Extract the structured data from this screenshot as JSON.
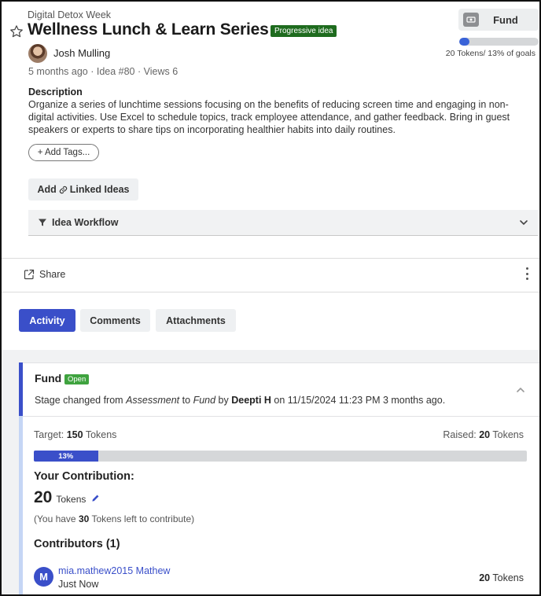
{
  "idea": {
    "campaign": "Digital Detox Week",
    "title": "Wellness Lunch & Learn Series",
    "status_badge": "Progressive idea",
    "author": "Josh Mulling",
    "meta": "5 months ago · Idea #80 · Views 6",
    "description_heading": "Description",
    "description": "Organize a series of lunchtime sessions focusing on the benefits of reducing screen time and engaging in non-digital activities. Use Excel to schedule topics, track employee attendance, and gather feedback. Bring in guest speakers or experts to share tips on incorporating healthier habits into daily routines.",
    "add_tags_label": "+ Add Tags...",
    "linked_ideas_prefix": "Add",
    "linked_ideas_label": "Linked Ideas",
    "workflow_label": "Idea Workflow"
  },
  "fund_widget": {
    "button_label": "Fund",
    "progress_fraction": 0.13,
    "summary": "20 Tokens/ 13% of goals"
  },
  "share": {
    "label": "Share"
  },
  "tabs": [
    {
      "label": "Activity",
      "active": true
    },
    {
      "label": "Comments",
      "active": false
    },
    {
      "label": "Attachments",
      "active": false
    }
  ],
  "activity_card": {
    "title": "Fund",
    "badge": "Open",
    "stage_prefix": "Stage changed from",
    "stage_from": "Assessment",
    "stage_to_word": "to",
    "stage_to": "Fund",
    "stage_by_word": "by",
    "stage_by": "Deepti H",
    "stage_date": "on 11/15/2024 11:23 PM 3 months ago.",
    "target_label": "Target:",
    "target_value": "150",
    "target_unit": "Tokens",
    "raised_label": "Raised:",
    "raised_value": "20",
    "raised_unit": "Tokens",
    "progress_fraction": 0.13,
    "progress_label": "13%",
    "your_contribution_heading": "Your Contribution:",
    "your_contribution_value": "20",
    "your_contribution_unit": "Tokens",
    "left_prefix": "(You have",
    "left_value": "30",
    "left_suffix": "Tokens left to contribute)",
    "contributors_heading": "Contributors (1)",
    "contributors": [
      {
        "initial": "M",
        "name": "mia.mathew2015 Mathew",
        "time": "Just Now",
        "tokens_value": "20",
        "tokens_unit": "Tokens"
      }
    ]
  },
  "colors": {
    "primary": "#3a4fc9",
    "progressive_badge": "#1e6b1e",
    "open_badge": "#3fa33f",
    "progress_track": "#d5d7d9"
  }
}
